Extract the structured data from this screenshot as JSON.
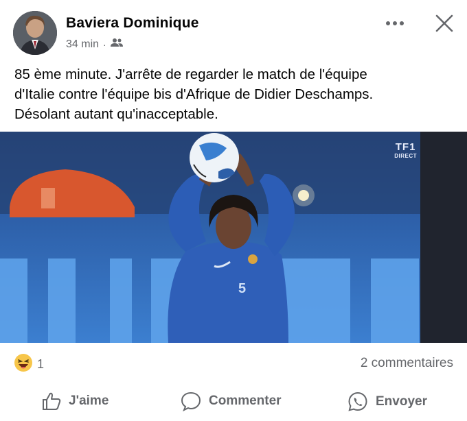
{
  "post": {
    "author": "Baviera Dominique",
    "time": "34 min",
    "separator": "·",
    "audience_icon": "friends-icon",
    "text_lines": [
      "85 ème minute. J'arrête de regarder le match de l'équipe",
      "d'Italie contre l'équipe bis d'Afrique de Didier Deschamps.",
      "Désolant autant qu'inacceptable."
    ]
  },
  "media": {
    "broadcaster_logo": "TF1",
    "broadcaster_tag": "DIRECT",
    "player_number": "5"
  },
  "reactions": {
    "emoji": "laughing-emoji",
    "count": "1",
    "comments": "2 commentaires"
  },
  "actions": {
    "like": "J'aime",
    "comment": "Commenter",
    "send": "Envoyer"
  },
  "colors": {
    "text": "#050505",
    "secondary": "#65676b",
    "pitch_blue": "#1f3a74",
    "jersey": "#2f5fb8"
  }
}
